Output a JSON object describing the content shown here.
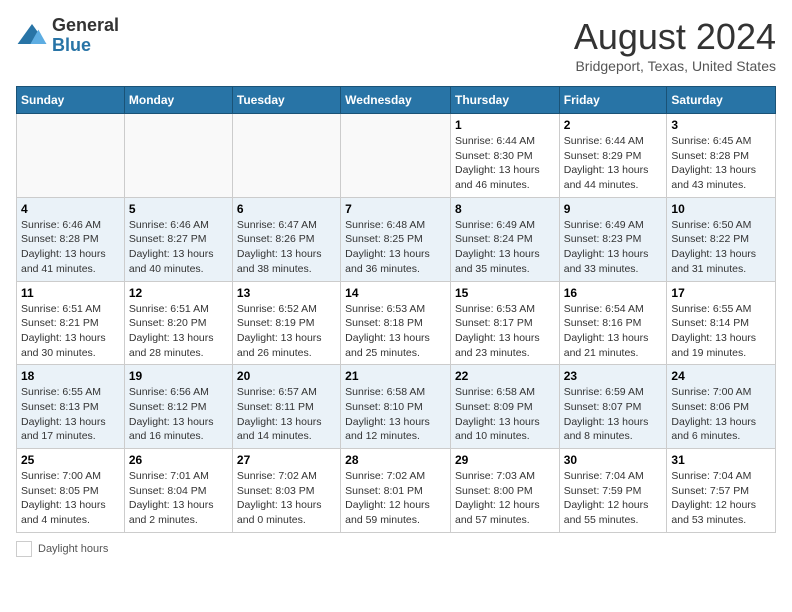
{
  "logo": {
    "general": "General",
    "blue": "Blue"
  },
  "header": {
    "month_year": "August 2024",
    "location": "Bridgeport, Texas, United States"
  },
  "days_of_week": [
    "Sunday",
    "Monday",
    "Tuesday",
    "Wednesday",
    "Thursday",
    "Friday",
    "Saturday"
  ],
  "weeks": [
    [
      {
        "day": "",
        "info": ""
      },
      {
        "day": "",
        "info": ""
      },
      {
        "day": "",
        "info": ""
      },
      {
        "day": "",
        "info": ""
      },
      {
        "day": "1",
        "info": "Sunrise: 6:44 AM\nSunset: 8:30 PM\nDaylight: 13 hours and 46 minutes."
      },
      {
        "day": "2",
        "info": "Sunrise: 6:44 AM\nSunset: 8:29 PM\nDaylight: 13 hours and 44 minutes."
      },
      {
        "day": "3",
        "info": "Sunrise: 6:45 AM\nSunset: 8:28 PM\nDaylight: 13 hours and 43 minutes."
      }
    ],
    [
      {
        "day": "4",
        "info": "Sunrise: 6:46 AM\nSunset: 8:28 PM\nDaylight: 13 hours and 41 minutes."
      },
      {
        "day": "5",
        "info": "Sunrise: 6:46 AM\nSunset: 8:27 PM\nDaylight: 13 hours and 40 minutes."
      },
      {
        "day": "6",
        "info": "Sunrise: 6:47 AM\nSunset: 8:26 PM\nDaylight: 13 hours and 38 minutes."
      },
      {
        "day": "7",
        "info": "Sunrise: 6:48 AM\nSunset: 8:25 PM\nDaylight: 13 hours and 36 minutes."
      },
      {
        "day": "8",
        "info": "Sunrise: 6:49 AM\nSunset: 8:24 PM\nDaylight: 13 hours and 35 minutes."
      },
      {
        "day": "9",
        "info": "Sunrise: 6:49 AM\nSunset: 8:23 PM\nDaylight: 13 hours and 33 minutes."
      },
      {
        "day": "10",
        "info": "Sunrise: 6:50 AM\nSunset: 8:22 PM\nDaylight: 13 hours and 31 minutes."
      }
    ],
    [
      {
        "day": "11",
        "info": "Sunrise: 6:51 AM\nSunset: 8:21 PM\nDaylight: 13 hours and 30 minutes."
      },
      {
        "day": "12",
        "info": "Sunrise: 6:51 AM\nSunset: 8:20 PM\nDaylight: 13 hours and 28 minutes."
      },
      {
        "day": "13",
        "info": "Sunrise: 6:52 AM\nSunset: 8:19 PM\nDaylight: 13 hours and 26 minutes."
      },
      {
        "day": "14",
        "info": "Sunrise: 6:53 AM\nSunset: 8:18 PM\nDaylight: 13 hours and 25 minutes."
      },
      {
        "day": "15",
        "info": "Sunrise: 6:53 AM\nSunset: 8:17 PM\nDaylight: 13 hours and 23 minutes."
      },
      {
        "day": "16",
        "info": "Sunrise: 6:54 AM\nSunset: 8:16 PM\nDaylight: 13 hours and 21 minutes."
      },
      {
        "day": "17",
        "info": "Sunrise: 6:55 AM\nSunset: 8:14 PM\nDaylight: 13 hours and 19 minutes."
      }
    ],
    [
      {
        "day": "18",
        "info": "Sunrise: 6:55 AM\nSunset: 8:13 PM\nDaylight: 13 hours and 17 minutes."
      },
      {
        "day": "19",
        "info": "Sunrise: 6:56 AM\nSunset: 8:12 PM\nDaylight: 13 hours and 16 minutes."
      },
      {
        "day": "20",
        "info": "Sunrise: 6:57 AM\nSunset: 8:11 PM\nDaylight: 13 hours and 14 minutes."
      },
      {
        "day": "21",
        "info": "Sunrise: 6:58 AM\nSunset: 8:10 PM\nDaylight: 13 hours and 12 minutes."
      },
      {
        "day": "22",
        "info": "Sunrise: 6:58 AM\nSunset: 8:09 PM\nDaylight: 13 hours and 10 minutes."
      },
      {
        "day": "23",
        "info": "Sunrise: 6:59 AM\nSunset: 8:07 PM\nDaylight: 13 hours and 8 minutes."
      },
      {
        "day": "24",
        "info": "Sunrise: 7:00 AM\nSunset: 8:06 PM\nDaylight: 13 hours and 6 minutes."
      }
    ],
    [
      {
        "day": "25",
        "info": "Sunrise: 7:00 AM\nSunset: 8:05 PM\nDaylight: 13 hours and 4 minutes."
      },
      {
        "day": "26",
        "info": "Sunrise: 7:01 AM\nSunset: 8:04 PM\nDaylight: 13 hours and 2 minutes."
      },
      {
        "day": "27",
        "info": "Sunrise: 7:02 AM\nSunset: 8:03 PM\nDaylight: 13 hours and 0 minutes."
      },
      {
        "day": "28",
        "info": "Sunrise: 7:02 AM\nSunset: 8:01 PM\nDaylight: 12 hours and 59 minutes."
      },
      {
        "day": "29",
        "info": "Sunrise: 7:03 AM\nSunset: 8:00 PM\nDaylight: 12 hours and 57 minutes."
      },
      {
        "day": "30",
        "info": "Sunrise: 7:04 AM\nSunset: 7:59 PM\nDaylight: 12 hours and 55 minutes."
      },
      {
        "day": "31",
        "info": "Sunrise: 7:04 AM\nSunset: 7:57 PM\nDaylight: 12 hours and 53 minutes."
      }
    ]
  ],
  "footer": {
    "daylight_label": "Daylight hours"
  }
}
